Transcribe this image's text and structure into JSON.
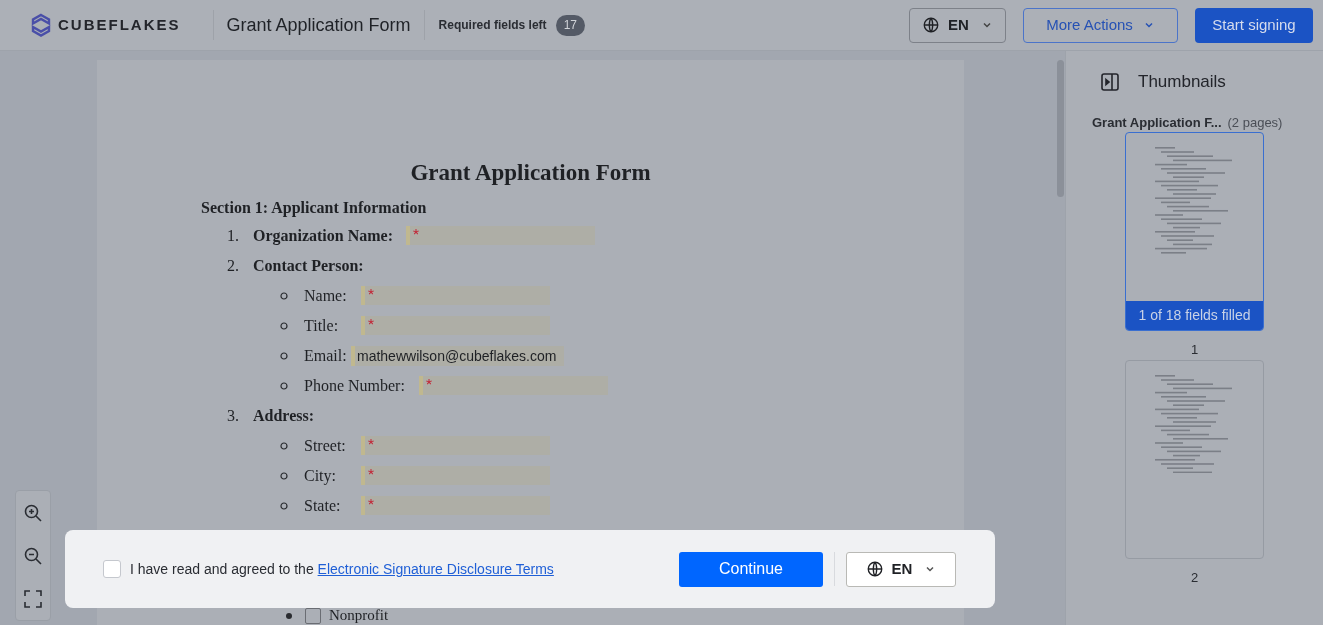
{
  "header": {
    "logo_text": "CUBEFLAKES",
    "document_title": "Grant Application Form",
    "required_label": "Required fields left",
    "required_count": "17",
    "language": "EN",
    "more_actions": "More Actions",
    "start_button": "Start signing"
  },
  "document": {
    "title": "Grant Application Form",
    "section": "Section 1: Applicant Information",
    "items": [
      {
        "number": "1.",
        "label": "Organization Name:",
        "field": {
          "required": true
        }
      },
      {
        "number": "2.",
        "label": "Contact Person:",
        "children": [
          {
            "label": "Name:",
            "field": {
              "required": true
            }
          },
          {
            "label": "Title:",
            "field": {
              "required": true
            }
          },
          {
            "label": "Email:",
            "field": {
              "required": false,
              "value": "mathewwilson@cubeflakes.com"
            }
          },
          {
            "label": "Phone Number:",
            "field": {
              "required": true
            }
          }
        ]
      },
      {
        "number": "3.",
        "label": "Address:",
        "children": [
          {
            "label": "Street:",
            "field": {
              "required": true
            }
          },
          {
            "label": "City:",
            "field": {
              "required": true
            }
          },
          {
            "label": "State:",
            "field": {
              "required": true
            }
          }
        ]
      }
    ],
    "partial_option": {
      "label": "Nonprofit",
      "checked": false
    }
  },
  "thumbnails": {
    "title": "Thumbnails",
    "file_name": "Grant Application F...",
    "page_count": "(2 pages)",
    "pages": [
      {
        "number": "1",
        "selected": true,
        "status": "1 of 18 fields filled"
      },
      {
        "number": "2",
        "selected": false
      }
    ]
  },
  "consent": {
    "checked": false,
    "text": "I have read and agreed to the ",
    "link": "Electronic Signature Disclosure Terms",
    "continue": "Continue",
    "language": "EN"
  }
}
